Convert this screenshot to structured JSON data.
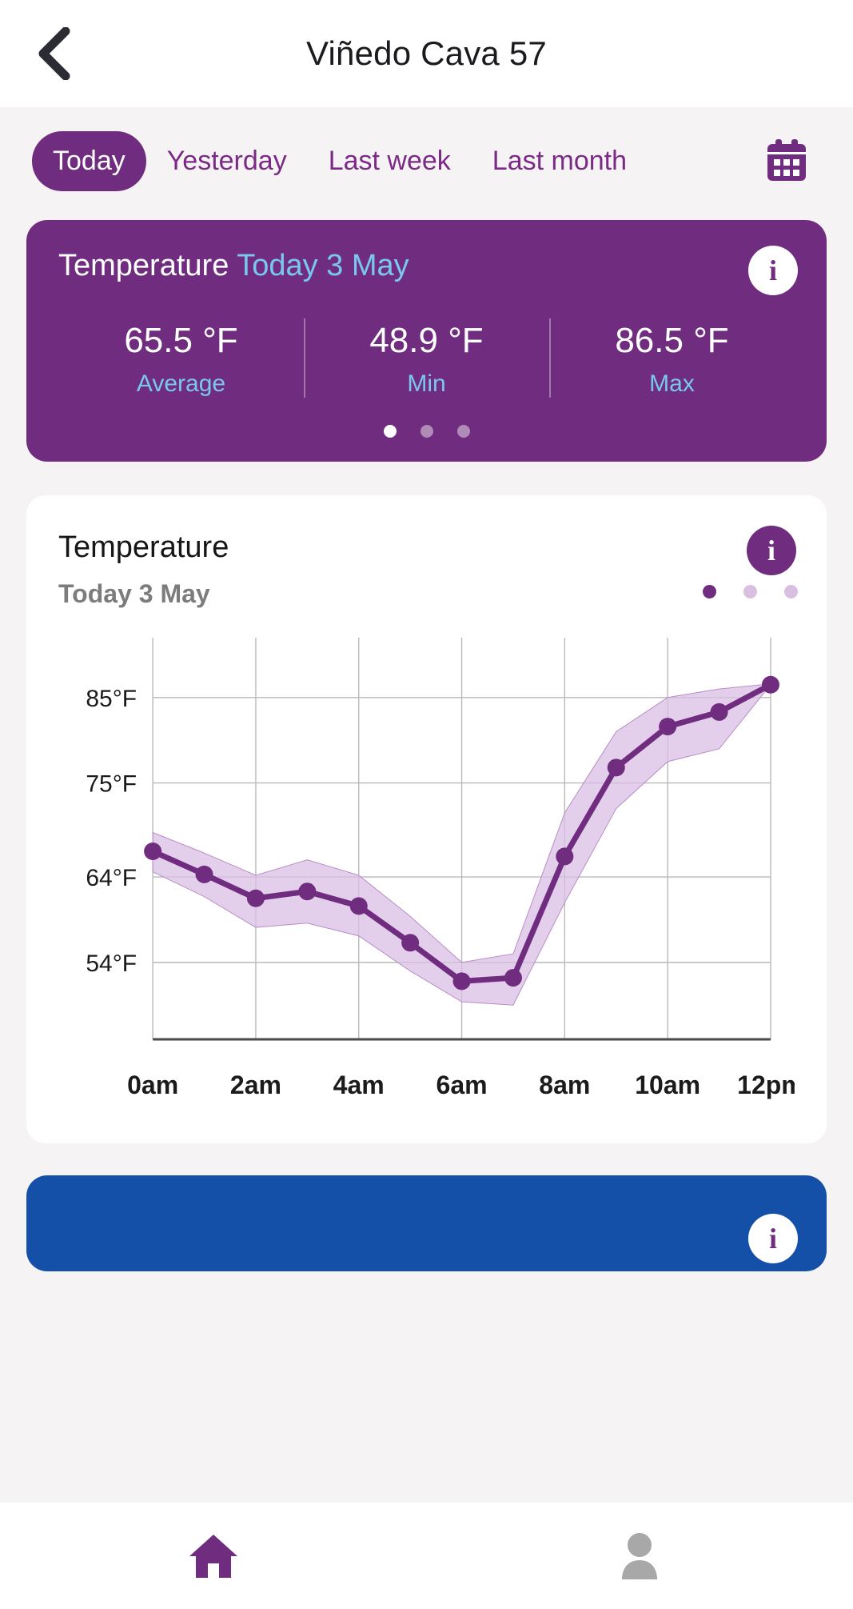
{
  "header": {
    "title": "Viñedo Cava 57",
    "back_icon": "chevron-left-icon"
  },
  "filters": {
    "tabs": [
      {
        "label": "Today",
        "active": true
      },
      {
        "label": "Yesterday",
        "active": false
      },
      {
        "label": "Last week",
        "active": false
      },
      {
        "label": "Last month",
        "active": false
      }
    ],
    "calendar_icon": "calendar-icon"
  },
  "summary_card": {
    "title": "Temperature",
    "subtitle": "Today 3 May",
    "info_icon": "info-icon",
    "stats": [
      {
        "value": "65.5 °F",
        "label": "Average"
      },
      {
        "value": "48.9 °F",
        "label": "Min"
      },
      {
        "value": "86.5 °F",
        "label": "Max"
      }
    ],
    "pager": {
      "count": 3,
      "active_index": 0
    },
    "colors": {
      "background": "#702d7f",
      "accent_text": "#79c7ed"
    }
  },
  "chart_card": {
    "title": "Temperature",
    "subtitle": "Today 3 May",
    "info_icon": "info-icon",
    "pager": {
      "count": 3,
      "active_index": 0
    }
  },
  "chart_data": {
    "type": "line",
    "title": "Temperature",
    "subtitle": "Today 3 May",
    "xlabel": "",
    "ylabel": "",
    "grid": true,
    "legend": "none",
    "x_tick_labels": [
      "0am",
      "2am",
      "4am",
      "6am",
      "8am",
      "10am",
      "12pm"
    ],
    "x_tick_values": [
      0,
      2,
      4,
      6,
      8,
      10,
      12
    ],
    "y_tick_labels": [
      "85°F",
      "75°F",
      "64°F",
      "54°F"
    ],
    "y_tick_values": [
      85,
      75,
      64,
      54
    ],
    "xlim": [
      0,
      12
    ],
    "ylim": [
      45,
      92
    ],
    "x": [
      0,
      1,
      2,
      3,
      4,
      5,
      6,
      7,
      8,
      9,
      10,
      11,
      12
    ],
    "series": [
      {
        "name": "Temperature",
        "color": "#702d7f",
        "values": [
          67.0,
          64.3,
          61.5,
          62.3,
          60.6,
          56.3,
          51.8,
          52.2,
          66.4,
          76.8,
          81.6,
          83.3,
          86.5
        ]
      }
    ],
    "band": {
      "name": "Min–Max range",
      "color": "#d9bfe4",
      "lower": [
        64.6,
        61.7,
        58.1,
        58.6,
        57.1,
        53.0,
        49.4,
        49.0,
        61.0,
        72.0,
        77.5,
        79.0,
        86.5
      ],
      "upper": [
        69.2,
        66.8,
        64.2,
        66.0,
        64.2,
        59.4,
        54.0,
        55.0,
        71.5,
        81.0,
        85.0,
        86.0,
        86.6
      ]
    }
  },
  "bottom_nav": {
    "items": [
      {
        "name": "home",
        "icon": "home-icon",
        "active": true
      },
      {
        "name": "profile",
        "icon": "person-icon",
        "active": false
      }
    ],
    "active_color": "#702d7f",
    "inactive_color": "#a8a8a8"
  }
}
